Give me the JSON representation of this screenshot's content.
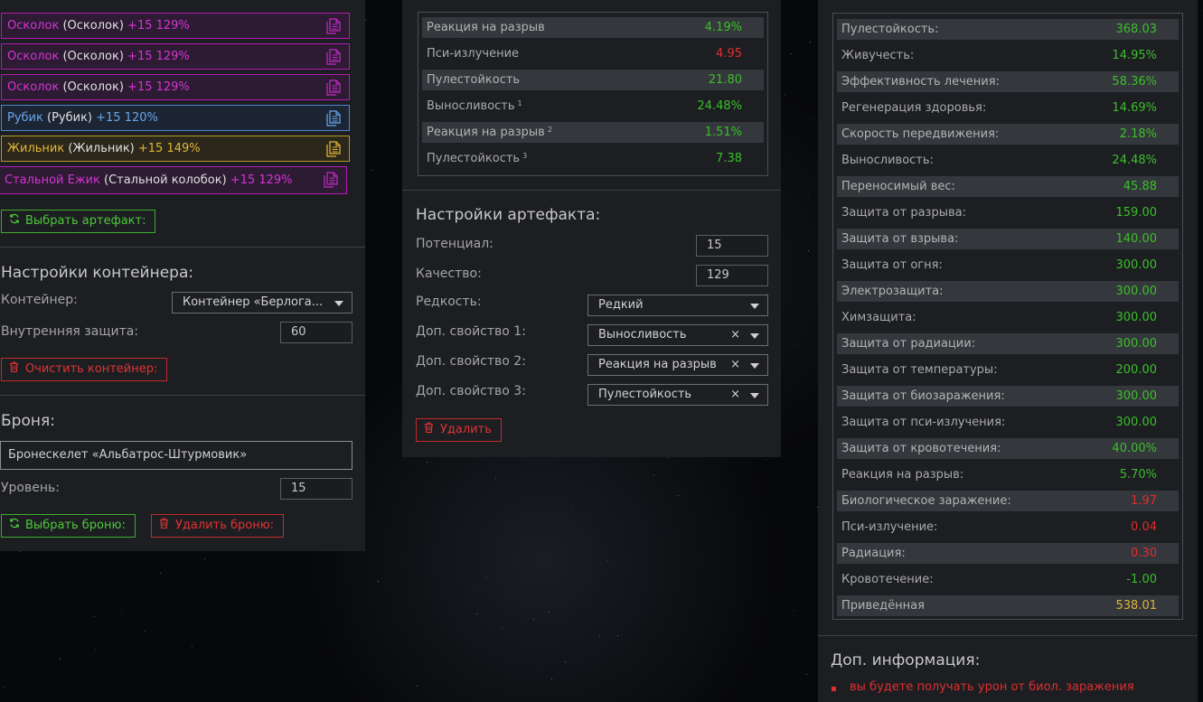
{
  "artifacts": [
    {
      "name": "Осколок",
      "base": "(Осколок)",
      "level": "+15 129%",
      "color": "purple"
    },
    {
      "name": "Осколок",
      "base": "(Осколок)",
      "level": "+15 129%",
      "color": "purple"
    },
    {
      "name": "Осколок",
      "base": "(Осколок)",
      "level": "+15 129%",
      "color": "purple"
    },
    {
      "name": "Рубик",
      "base": "(Рубик)",
      "level": "+15 120%",
      "color": "blue"
    },
    {
      "name": "Жильник",
      "base": "(Жильник)",
      "level": "+15 149%",
      "color": "gold"
    },
    {
      "name": "Стальной Ежик",
      "base": "(Стальной колобок)",
      "level": "+15 129%",
      "color": "purple"
    }
  ],
  "select_artifact_label": "Выбрать артефакт:",
  "container": {
    "title": "Настройки контейнера:",
    "container_label": "Контейнер:",
    "container_value": "Контейнер «Берлога...",
    "protection_label": "Внутренняя защита:",
    "protection_value": "60",
    "clear_label": "Очистить контейнер:"
  },
  "armor": {
    "title": "Броня:",
    "name": "Бронескелет «Альбатрос-Штурмовик»",
    "level_label": "Уровень:",
    "level_value": "15",
    "select_label": "Выбрать броню:",
    "delete_label": "Удалить броню:"
  },
  "artifact_stats": [
    {
      "name": "Реакция на разрыв",
      "sup": "",
      "value": "4.19%",
      "tone": "good"
    },
    {
      "name": "Пси-излучение",
      "sup": "",
      "value": "4.95",
      "tone": "bad"
    },
    {
      "name": "Пулестойкость",
      "sup": "",
      "value": "21.80",
      "tone": "good"
    },
    {
      "name": "Выносливость",
      "sup": "1",
      "value": "24.48%",
      "tone": "good"
    },
    {
      "name": "Реакция на разрыв",
      "sup": "2",
      "value": "1.51%",
      "tone": "good"
    },
    {
      "name": "Пулестойкость",
      "sup": "3",
      "value": "7.38",
      "tone": "good"
    }
  ],
  "artifact_settings": {
    "title": "Настройки артефакта:",
    "potential_label": "Потенциал:",
    "potential_value": "15",
    "quality_label": "Качество:",
    "quality_value": "129",
    "rarity_label": "Редкость:",
    "rarity_value": "Редкий",
    "extra1_label": "Доп. свойство 1:",
    "extra1_value": "Выносливость",
    "extra2_label": "Доп. свойство 2:",
    "extra2_value": "Реакция на разрыв",
    "extra3_label": "Доп. свойство 3:",
    "extra3_value": "Пулестойкость",
    "clear_symbol": "×",
    "delete_label": "Удалить"
  },
  "total_stats": [
    {
      "name": "Пулестойкость:",
      "value": "368.03",
      "tone": "good"
    },
    {
      "name": "Живучесть:",
      "value": "14.95%",
      "tone": "good"
    },
    {
      "name": "Эффективность лечения:",
      "value": "58.36%",
      "tone": "good"
    },
    {
      "name": "Регенерация здоровья:",
      "value": "14.69%",
      "tone": "good"
    },
    {
      "name": "Скорость передвижения:",
      "value": "2.18%",
      "tone": "good"
    },
    {
      "name": "Выносливость:",
      "value": "24.48%",
      "tone": "good"
    },
    {
      "name": "Переносимый вес:",
      "value": "45.88",
      "tone": "good"
    },
    {
      "name": "Защита от разрыва:",
      "value": "159.00",
      "tone": "good"
    },
    {
      "name": "Защита от взрыва:",
      "value": "140.00",
      "tone": "good"
    },
    {
      "name": "Защита от огня:",
      "value": "300.00",
      "tone": "good"
    },
    {
      "name": "Электрозащита:",
      "value": "300.00",
      "tone": "good"
    },
    {
      "name": "Химзащита:",
      "value": "300.00",
      "tone": "good"
    },
    {
      "name": "Защита от радиации:",
      "value": "300.00",
      "tone": "good"
    },
    {
      "name": "Защита от температуры:",
      "value": "200.00",
      "tone": "good"
    },
    {
      "name": "Защита от биозаражения:",
      "value": "300.00",
      "tone": "good"
    },
    {
      "name": "Защита от пси-излучения:",
      "value": "300.00",
      "tone": "good"
    },
    {
      "name": "Защита от кровотечения:",
      "value": "40.00%",
      "tone": "good"
    },
    {
      "name": "Реакция на разрыв:",
      "value": "5.70%",
      "tone": "good"
    },
    {
      "name": "Биологическое заражение:",
      "value": "1.97",
      "tone": "bad"
    },
    {
      "name": "Пси-излучение:",
      "value": "0.04",
      "tone": "bad"
    },
    {
      "name": "Радиация:",
      "value": "0.30",
      "tone": "bad"
    },
    {
      "name": "Кровотечение:",
      "value": "-1.00",
      "tone": "good"
    },
    {
      "name": "Приведённая",
      "value": "538.01",
      "tone": "gold"
    }
  ],
  "extra_info": {
    "title": "Доп. информация:",
    "items": [
      "вы будете получать урон от биол. заражения"
    ]
  },
  "colors": {
    "good": "#3cbf2a",
    "bad": "#e02e2e",
    "gold": "#e0b33a",
    "purple": "#b41ab4",
    "blue": "#4d87d6"
  }
}
